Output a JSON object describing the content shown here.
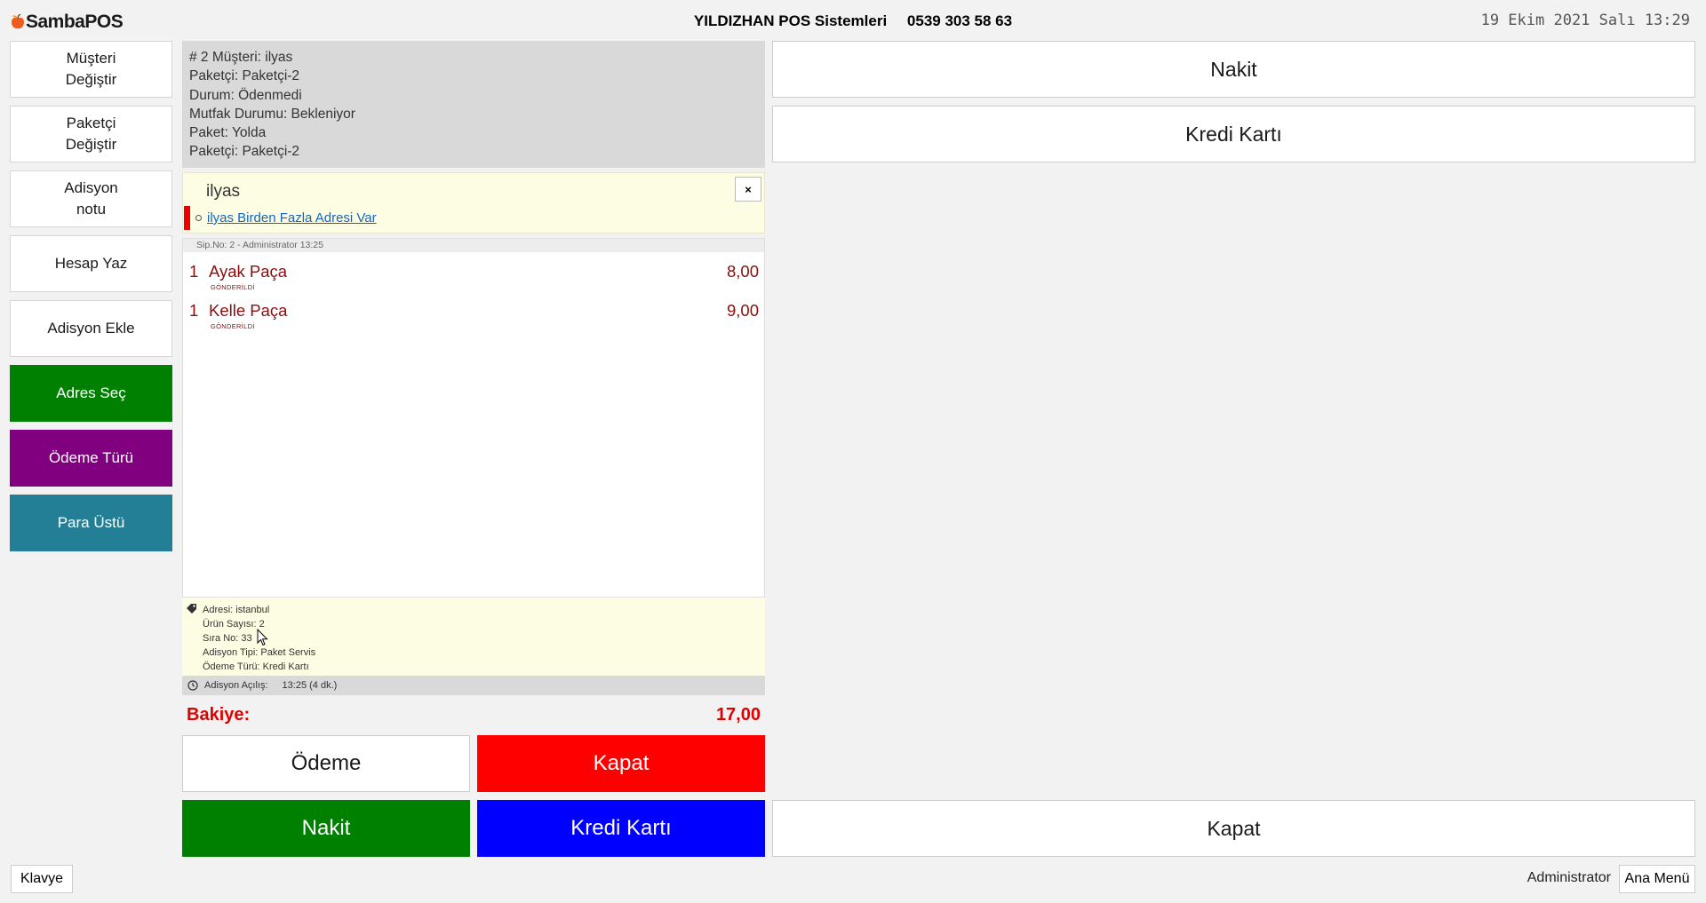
{
  "header": {
    "logo_text": "SambaPOS",
    "company": "YILDIZHAN POS Sistemleri",
    "phone": "0539 303 58 63",
    "datetime": "19 Ekim 2021 Salı 13:29"
  },
  "left_buttons": [
    {
      "label": "Müşteri\nDeğiştir"
    },
    {
      "label": "Paketçi\nDeğiştir"
    },
    {
      "label": "Adisyon\nnotu"
    },
    {
      "label": "Hesap Yaz"
    },
    {
      "label": "Adisyon Ekle"
    },
    {
      "label": "Adres Seç",
      "color": "#008000"
    },
    {
      "label": "Ödeme Türü",
      "color": "#800080"
    },
    {
      "label": "Para Üstü",
      "color": "#237f95"
    }
  ],
  "ticket": {
    "info_lines": [
      "# 2 Müşteri: ilyas",
      "Paketçi: Paketçi-2",
      "Durum: Ödenmedi",
      "Mutfak Durumu: Bekleniyor",
      "Paket: Yolda",
      "Paketçi: Paketçi-2"
    ],
    "customer_name": "ilyas",
    "customer_warning": "ilyas Birden Fazla Adresi Var",
    "close_symbol": "×",
    "orders_header": "Sip.No: 2 - Administrator  13:25",
    "orders": [
      {
        "qty": "1",
        "name": "Ayak Paça",
        "price": "8,00",
        "status": "GÖNDERİLDİ"
      },
      {
        "qty": "1",
        "name": "Kelle Paça",
        "price": "9,00",
        "status": "GÖNDERİLDİ"
      }
    ],
    "summary_lines": [
      "Adresi: istanbul",
      "Ürün Sayısı: 2",
      "Sıra No: 33",
      "Adisyon Tipi: Paket Servis",
      "Ödeme Türü: Kredi Kartı"
    ],
    "opened_label": "Adisyon Açılış:",
    "opened_value": "13:25 (4 dk.)",
    "balance_label": "Bakiye:",
    "balance_value": "17,00"
  },
  "actions": {
    "odeme": "Ödeme",
    "kapat": "Kapat",
    "nakit": "Nakit",
    "kredi": "Kredi Kartı"
  },
  "right": {
    "nakit": "Nakit",
    "kredi": "Kredi Kartı",
    "kapat": "Kapat"
  },
  "footer": {
    "klavye": "Klavye",
    "user": "Administrator",
    "ana_menu": "Ana Menü"
  },
  "colors": {
    "accent_red": "#ff0000",
    "green": "#008000",
    "purple": "#800080",
    "teal": "#237f95",
    "blue": "#0000ff",
    "order_text": "#8b0d0d"
  }
}
